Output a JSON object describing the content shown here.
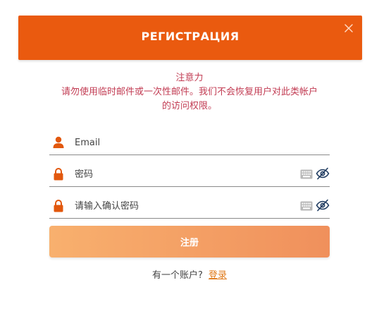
{
  "header": {
    "title": "РЕГИСТРАЦИЯ",
    "close_icon": "close-icon",
    "background_color": "#ea5a0f"
  },
  "notice": {
    "title": "注意力",
    "line1": "请勿使用临时邮件或一次性邮件。我们不会恢复用户对此类帐户",
    "line2": "的访问权限。",
    "color": "#c23c53"
  },
  "form": {
    "email": {
      "placeholder": "Email",
      "value": "",
      "icon": "user-icon"
    },
    "password": {
      "placeholder": "密码",
      "value": "",
      "icon": "lock-icon"
    },
    "confirm_password": {
      "placeholder": "请输入确认密码",
      "value": "",
      "icon": "lock-icon"
    },
    "submit_label": "注册"
  },
  "footer": {
    "prompt": "有一个账户?",
    "login_label": "登录"
  }
}
